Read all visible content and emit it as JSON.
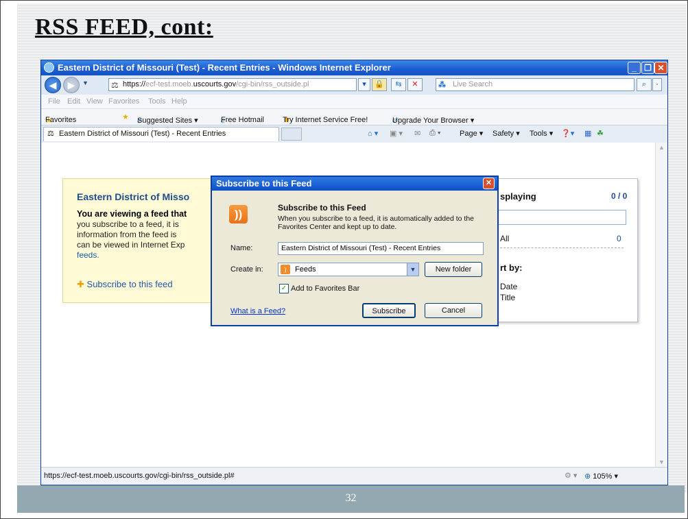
{
  "slide": {
    "title": "RSS FEED, cont:",
    "page_number": "32"
  },
  "window": {
    "title": "Eastern District of Missouri (Test) - Recent Entries - Windows Internet Explorer"
  },
  "address": {
    "url_prefix": "https://",
    "url_host_dim": "ecf-test.moeb.",
    "url_host": "uscourts.gov",
    "url_path": "/cgi-bin/rss_outside.pl",
    "search_placeholder": "Live Search"
  },
  "menu": [
    "File",
    "Edit",
    "View",
    "Favorites",
    "Tools",
    "Help"
  ],
  "favorites_bar": {
    "favorites": "Favorites",
    "items": [
      "Suggested Sites ▾",
      "Free Hotmail",
      "Try Internet Service Free!",
      "Upgrade Your Browser ▾"
    ]
  },
  "tab": {
    "label": "Eastern District of Missouri (Test) - Recent Entries"
  },
  "commands": [
    "Page ▾",
    "Safety ▾",
    "Tools ▾"
  ],
  "feed": {
    "title": "Eastern District of Misso",
    "body_bold": "You are viewing a feed that",
    "body_lines": [
      "you subscribe to a feed, it is",
      "information from the feed is",
      "can be viewed in Internet Exp"
    ],
    "feeds_link": "feeds.",
    "subscribe_link": "Subscribe to this feed"
  },
  "sidebar": {
    "displaying": "splaying",
    "count": "0 / 0",
    "all_label": "All",
    "all_count": "0",
    "sort_by": "rt by:",
    "sort_date": "Date",
    "sort_title": "Title"
  },
  "dialog": {
    "title": "Subscribe to this Feed",
    "heading": "Subscribe to this Feed",
    "description": "When you subscribe to a feed, it is automatically added to the Favorites Center and kept up to date.",
    "name_label": "Name:",
    "name_value": "Eastern District of Missouri (Test) - Recent Entries",
    "create_in_label": "Create in:",
    "create_in_value": "Feeds",
    "new_folder": "New folder",
    "add_fav_bar": "Add to Favorites Bar",
    "what_is": "What is a Feed?",
    "subscribe": "Subscribe",
    "cancel": "Cancel"
  },
  "status": {
    "url": "https://ecf-test.moeb.uscourts.gov/cgi-bin/rss_outside.pl#",
    "zoom": "105%"
  }
}
